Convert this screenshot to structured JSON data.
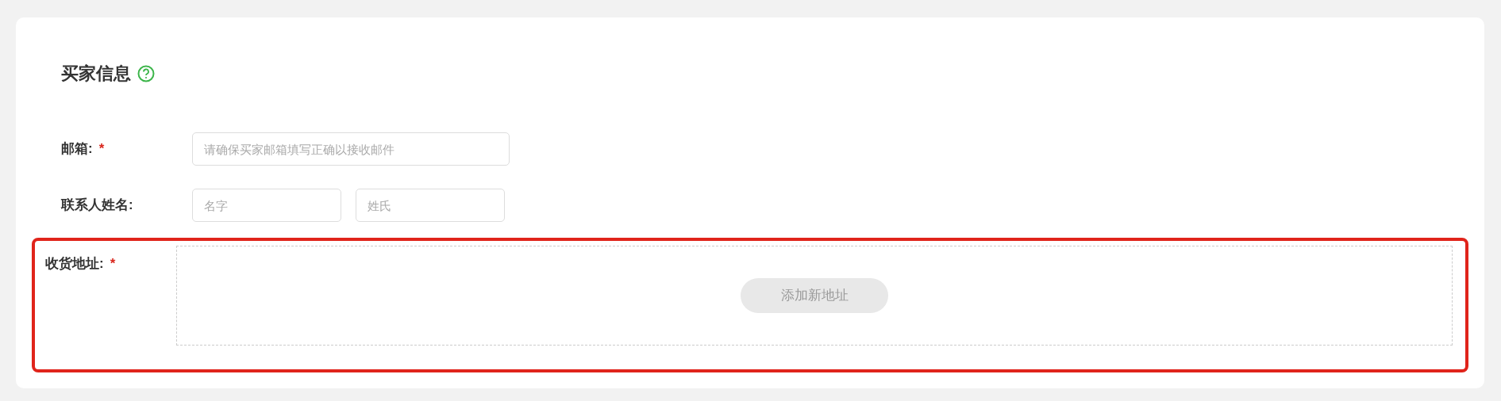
{
  "section": {
    "title": "买家信息"
  },
  "fields": [
    {
      "kind": "single",
      "label": "邮箱:",
      "required_mark": "*",
      "inputs": [
        {
          "placeholder": "请确保买家邮箱填写正确以接收邮件"
        }
      ]
    },
    {
      "kind": "pair",
      "label": "联系人姓名:",
      "inputs": [
        {
          "placeholder": "名字"
        },
        {
          "placeholder": "姓氏"
        }
      ]
    },
    {
      "kind": "address",
      "label": "收货地址:",
      "required_mark": "*",
      "highlighted": true,
      "button": {
        "label": "添加新地址",
        "disabled": true
      }
    }
  ]
}
